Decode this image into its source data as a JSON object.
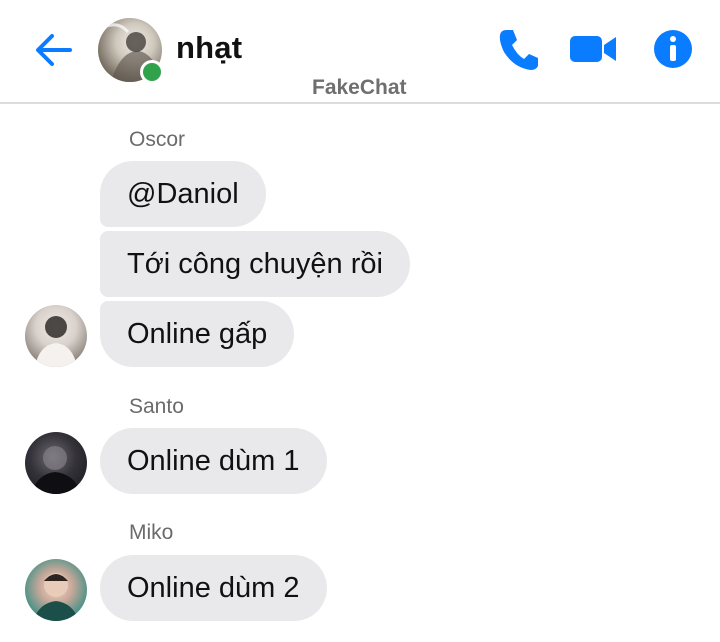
{
  "header": {
    "contact_name": "nhạt",
    "watermark": "FakeChat",
    "icons": {
      "back": "arrow-left-icon",
      "call": "phone-icon",
      "video": "video-camera-icon",
      "info": "info-icon"
    },
    "accent_color": "#0a7cff",
    "online_color": "#31a24c"
  },
  "messages": [
    {
      "sender": "Oscor",
      "bubbles": [
        "@Daniol",
        "Tới công chuyện rồi",
        "Online gấp"
      ]
    },
    {
      "sender": "Santo",
      "bubbles": [
        "Online dùm 1"
      ]
    },
    {
      "sender": "Miko",
      "bubbles": [
        "Online dùm 2"
      ]
    }
  ],
  "colors": {
    "bubble_background": "#e9e9eb",
    "sender_label": "#6b6b6b"
  }
}
